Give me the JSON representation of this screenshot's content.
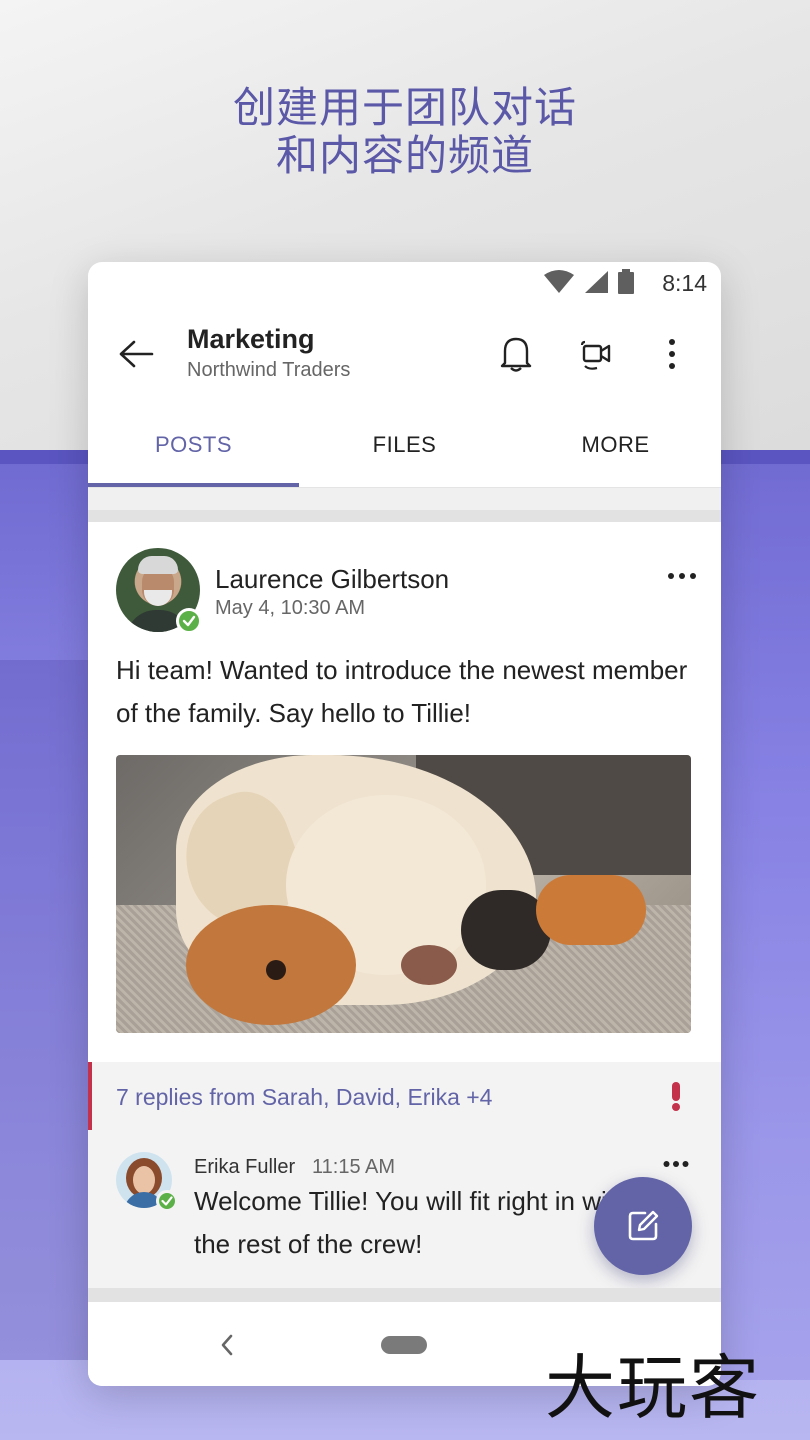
{
  "headline": {
    "line1": "创建用于团队对话",
    "line2": "和内容的频道"
  },
  "status_bar": {
    "time": "8:14",
    "icons": [
      "wifi-icon",
      "signal-icon",
      "battery-icon"
    ]
  },
  "header": {
    "title": "Marketing",
    "subtitle": "Northwind Traders",
    "icons": [
      "back-arrow-icon",
      "bell-icon",
      "meet-now-icon",
      "more-vertical-icon"
    ]
  },
  "tabs": [
    {
      "label": "POSTS",
      "active": true
    },
    {
      "label": "FILES",
      "active": false
    },
    {
      "label": "MORE",
      "active": false
    }
  ],
  "post": {
    "author": "Laurence Gilbertson",
    "timestamp": "May 4, 10:30 AM",
    "text": "Hi team! Wanted to introduce the newest member of the family. Say hello to Tillie!",
    "presence": "available"
  },
  "replies": {
    "summary": "7 replies from Sarah, David, Erika +4",
    "important": true,
    "latest": {
      "author": "Erika Fuller",
      "time": "11:15 AM",
      "text": "Welcome Tillie! You will fit right in with the rest of the crew!",
      "presence": "available"
    }
  },
  "fab": {
    "icon": "compose-icon"
  },
  "watermark": "大玩客",
  "colors": {
    "accent": "#6264a7",
    "presence_available": "#5bb147",
    "important": "#c4314b",
    "headline": "#5b58a8"
  }
}
